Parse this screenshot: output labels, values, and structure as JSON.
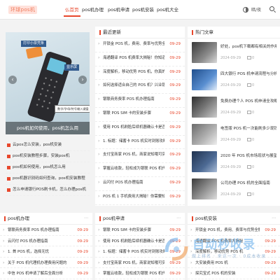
{
  "header": {
    "logo_text": "环球pos机",
    "nav": [
      "仏首页",
      "pos机办理",
      "pos机申请",
      "pos机安装",
      "pos机大全"
    ],
    "theme_label": "暗/夜"
  },
  "carousel": {
    "callout_top": "打印小票凭条",
    "callout_right": "显示屏",
    "callout_bottom": "数字/字母/符号输入键盘",
    "caption": "pos机如何使用，pos机怎么用"
  },
  "left_list": [
    "云pos怎么安装，pos机安装",
    "pos机安装教程步骤，安装pos机",
    "pos机如何使用，pos机怎么用",
    "pos机器识别码如何查询，pos机安装教程",
    "怎么申请银行POS刷卡机，怎么办理pos机"
  ],
  "latest": {
    "title": "最近更新",
    "items": [
      {
        "text": "开锁金 POS 机，费用、费率与优势全解析！",
        "date": "09-29"
      },
      {
        "text": "海通翻译 POS 机费率大揭秘！你知道的不一...",
        "date": "09-29"
      },
      {
        "text": "深度解析，移动优势 POS 机，你真的了解吗...",
        "date": "09-29"
      },
      {
        "text": "如何选择适合自己的 POS 机？兴业银行 POS...",
        "date": "09-29"
      },
      {
        "text": "银联商务费率 POS 机办理指南",
        "date": "09-29"
      },
      {
        "text": "银联 POS SIM 卡的安装步骤",
        "date": "09-29"
      },
      {
        "text": "使用 POS 机刷脸后续机器确认卡是否会生？",
        "date": "09-29"
      },
      {
        "text": "1. 标题：储蓄卡 POS 机实时到账攻略，招行...",
        "date": "09-29"
      },
      {
        "text": "支付宝商家 POS 机，商家说知哦可实现？",
        "date": "09-29"
      },
      {
        "text": "掌握云收款，轻松成为银联 POS 机代理商...",
        "date": "09-29"
      },
      {
        "text": "云闪付 POS 机办理指南",
        "date": "09-29"
      },
      {
        "text": "POS 机 1 手机费用大揭秘！你需要知道的那...",
        "date": "09-29"
      }
    ]
  },
  "hot": {
    "title": "热门文章",
    "items": [
      {
        "title": "好处，pos机下载都有相关的作用",
        "date": "2024-09-29",
        "comments": "0"
      },
      {
        "title": "四大银行 POS 机申请流程与分析",
        "date": "2024-09-29",
        "comments": "0"
      },
      {
        "title": "免费办理个人 POS 机申请全攻略",
        "date": "2024-09-29",
        "comments": "0"
      },
      {
        "title": "电签版 POS 机一次能刷多少现钱？",
        "date": "2024-09-29",
        "comments": "0"
      },
      {
        "title": "2020 年 POS 机市场现状与展望",
        "date": "2024-09-29",
        "comments": "0"
      },
      {
        "title": "公司办理 POS 机的全面指南",
        "date": "2024-09-29",
        "comments": "0"
      }
    ]
  },
  "section_handle": {
    "title": "pos机办理",
    "items": [
      {
        "text": "银联商务费率 POS 机办理指南",
        "date": "09-29"
      },
      {
        "text": "云闪付 POS 机办理指南",
        "date": "09-29"
      },
      {
        "text": "1. 首 POS 机，选择无忧",
        "date": "09-29"
      },
      {
        "text": "关于 POS 机代理机办理费用问题的",
        "date": "09-29"
      },
      {
        "text": "中信 POS 机申请了解后全面分析",
        "date": "09-29"
      }
    ]
  },
  "section_apply": {
    "title": "pos机申请",
    "items": [
      {
        "text": "银联 POS SIM 卡的安装步骤",
        "date": "09-29"
      },
      {
        "text": "使用 POS 机刷脸后续机器确认卡是否会生？",
        "date": "09-29"
      },
      {
        "text": "1. 标题：储蓄卡 POS 机实时到账攻略...",
        "date": "09-29"
      },
      {
        "text": "支付宝商家 POS 机，商家说知哦可实现？",
        "date": "09-29"
      },
      {
        "text": "掌握云收款，轻松成为银联 POS 机代理商",
        "date": "09-29"
      }
    ]
  },
  "section_install": {
    "title": "pos机安装",
    "items": [
      {
        "text": "开锁金 POS 机，费用、费率与优势全解析",
        "date": "09-29"
      },
      {
        "text": "海通翻译 POS 机费率大揭秘",
        "date": "09-29"
      },
      {
        "text": "深度解析，移动优势 POS 机",
        "date": "09-29"
      },
      {
        "text": "大安装费用 POS 机",
        "date": "09-29"
      },
      {
        "text": "探究宝式 POS 机的安装",
        "date": "09-29"
      }
    ]
  },
  "watermark": {
    "text": "自动秒收录",
    "sub": "做上排名 · 来访一次 · 0成本收录"
  }
}
